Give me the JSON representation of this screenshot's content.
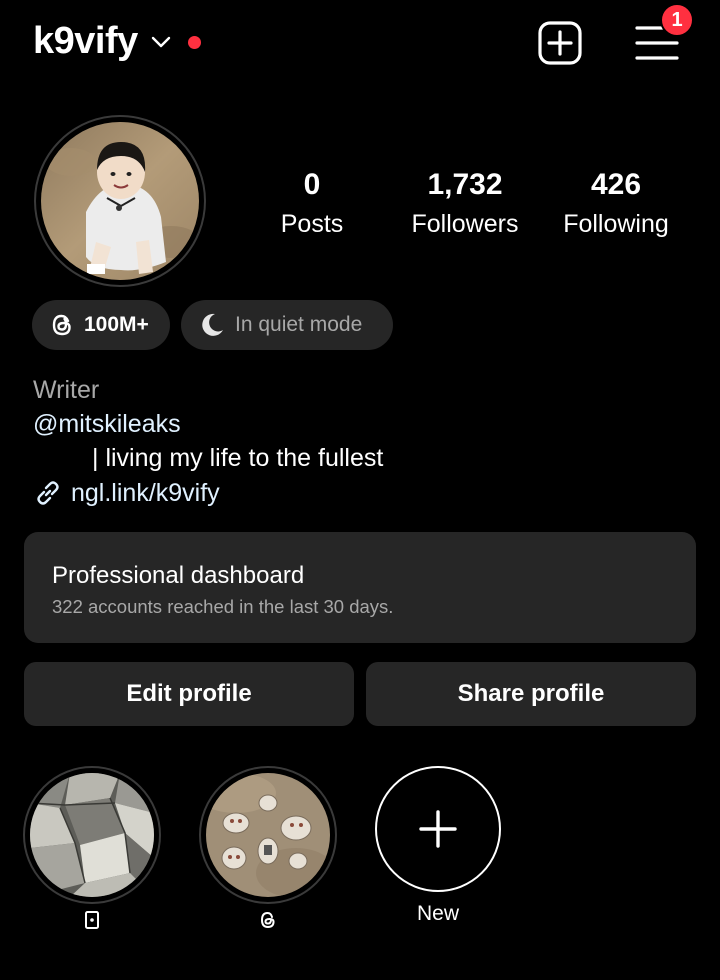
{
  "header": {
    "username": "k9vify",
    "notification_count": "1",
    "live_dot_color": "#ff3040",
    "badge_color": "#ff3040",
    "icons": [
      "chevron-down-icon",
      "new-post-icon",
      "menu-icon"
    ]
  },
  "profile": {
    "stats": [
      {
        "value": "0",
        "label": "Posts"
      },
      {
        "value": "1,732",
        "label": "Followers"
      },
      {
        "value": "426",
        "label": "Following"
      }
    ],
    "threads_pill": "100M+",
    "quiet_pill": "In quiet mode",
    "bio": {
      "category": "Writer",
      "mention": "@mitskileaks",
      "text": "| living my life to the fullest",
      "link": "ngl.link/k9vify"
    }
  },
  "dashboard": {
    "title": "Professional dashboard",
    "subtitle": "322 accounts reached in the last 30 days."
  },
  "actions": {
    "edit": "Edit profile",
    "share": "Share profile"
  },
  "highlights": {
    "items": [
      {
        "label": "▫",
        "icon": "card-icon"
      },
      {
        "label": "◌",
        "icon": "threads-icon"
      }
    ],
    "new_label": "New"
  }
}
